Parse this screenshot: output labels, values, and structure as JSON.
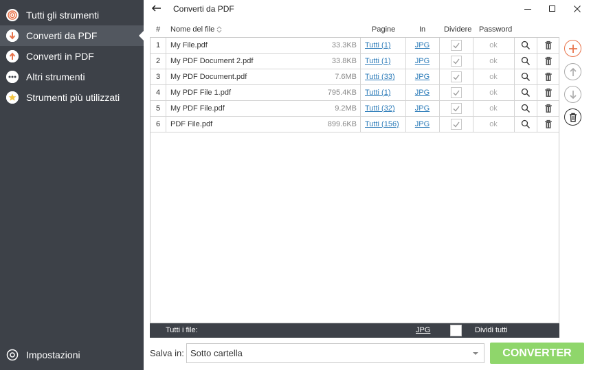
{
  "sidebar": {
    "items": [
      {
        "label": "Tutti gli strumenti",
        "icon": "target-icon",
        "color": "#e8734a"
      },
      {
        "label": "Converti da PDF",
        "icon": "arrow-down-icon",
        "color": "#e8734a"
      },
      {
        "label": "Converti in PDF",
        "icon": "arrow-up-icon",
        "color": "#e8734a"
      },
      {
        "label": "Altri strumenti",
        "icon": "more-icon",
        "color": "#ffffff"
      },
      {
        "label": "Strumenti più utilizzati",
        "icon": "star-icon",
        "color": "#f4c542"
      }
    ],
    "settings_label": "Impostazioni"
  },
  "window": {
    "title": "Converti da PDF"
  },
  "table": {
    "headers": {
      "index": "#",
      "name": "Nome del file",
      "pages": "Pagine",
      "in": "In",
      "split": "Dividere",
      "password": "Password"
    },
    "rows": [
      {
        "index": "1",
        "name": "My File.pdf",
        "size": "33.3KB",
        "pages": "Tutti (1)",
        "format": "JPG",
        "split": true,
        "password": "ok"
      },
      {
        "index": "2",
        "name": "My PDF Document 2.pdf",
        "size": "33.8KB",
        "pages": "Tutti (1)",
        "format": "JPG",
        "split": true,
        "password": "ok"
      },
      {
        "index": "3",
        "name": "My PDF Document.pdf",
        "size": "7.6MB",
        "pages": "Tutti (33)",
        "format": "JPG",
        "split": true,
        "password": "ok"
      },
      {
        "index": "4",
        "name": "My PDF File 1.pdf",
        "size": "795.4KB",
        "pages": "Tutti (1)",
        "format": "JPG",
        "split": true,
        "password": "ok"
      },
      {
        "index": "5",
        "name": "My PDF File.pdf",
        "size": "9.2MB",
        "pages": "Tutti (32)",
        "format": "JPG",
        "split": true,
        "password": "ok"
      },
      {
        "index": "6",
        "name": "PDF File.pdf",
        "size": "899.6KB",
        "pages": "Tutti (156)",
        "format": "JPG",
        "split": true,
        "password": "ok"
      }
    ]
  },
  "footer": {
    "all_files_label": "Tutti i file:",
    "all_format": "JPG",
    "split_all_label": "Dividi tutti"
  },
  "bottom": {
    "save_in_label": "Salva in:",
    "save_in_value": "Sotto cartella",
    "convert_label": "CONVERTER"
  },
  "colors": {
    "sidebar_bg": "#3d4148",
    "accent_orange": "#e8734a",
    "convert_green": "#8fd66b",
    "link_blue": "#2a7ab8"
  }
}
